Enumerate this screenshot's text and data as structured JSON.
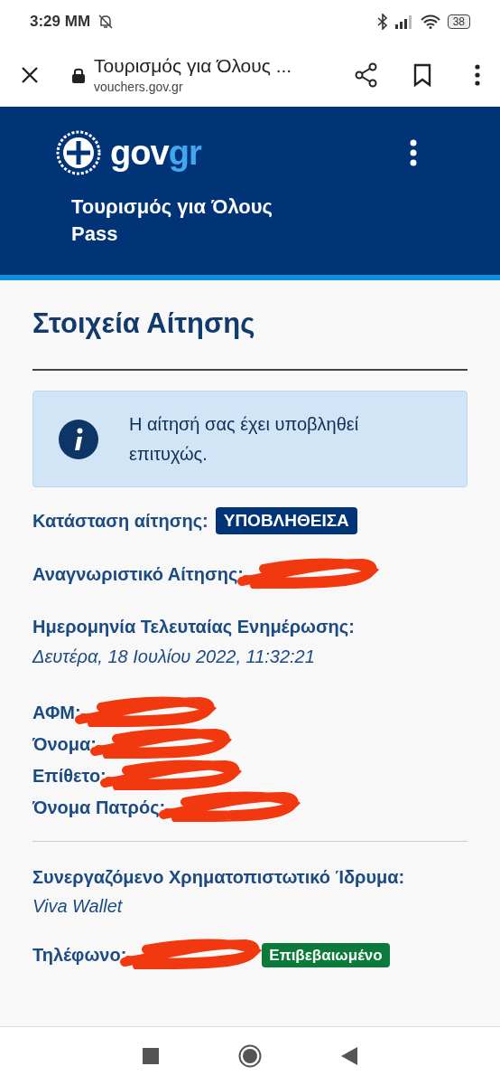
{
  "status_bar": {
    "time": "3:29 MM",
    "battery": "38"
  },
  "browser_bar": {
    "title": "Τουρισμός για Όλους ...",
    "url": "vouchers.gov.gr"
  },
  "header": {
    "logo_part_1": "gov",
    "logo_part_2": "gr",
    "title": "Τουρισμός για Όλους Pass"
  },
  "page_title": "Στοιχεία Αίτησης",
  "alert": {
    "text": "Η αίτησή σας έχει υποβληθεί επιτυχώς."
  },
  "fields": [
    {
      "kind": "badge",
      "label": "Κατάσταση αίτησης:",
      "value": "ΥΠΟΒΛΗΘΕΙΣΑ"
    },
    {
      "kind": "redacted",
      "label": "Αναγνωριστικό Αίτησης:"
    },
    {
      "kind": "date",
      "label": "Ημερομηνία Τελευταίας Ενημέρωσης:",
      "value": "Δευτέρα, 18 Ιουλίου 2022, 11:32:21"
    },
    {
      "kind": "redacted",
      "label": "ΑΦΜ:"
    },
    {
      "kind": "redacted",
      "label": "Όνομα:"
    },
    {
      "kind": "redacted",
      "label": "Επίθετο:"
    },
    {
      "kind": "redacted",
      "label": "Όνομα Πατρός:"
    },
    {
      "kind": "divider"
    },
    {
      "kind": "text",
      "label": "Συνεργαζόμενο Χρηματοπιστωτικό Ίδρυμα:",
      "value": "Viva Wallet"
    },
    {
      "kind": "redacted_badge",
      "label": "Τηλέφωνο:",
      "value": "Επιβεβαιωμένο"
    }
  ]
}
